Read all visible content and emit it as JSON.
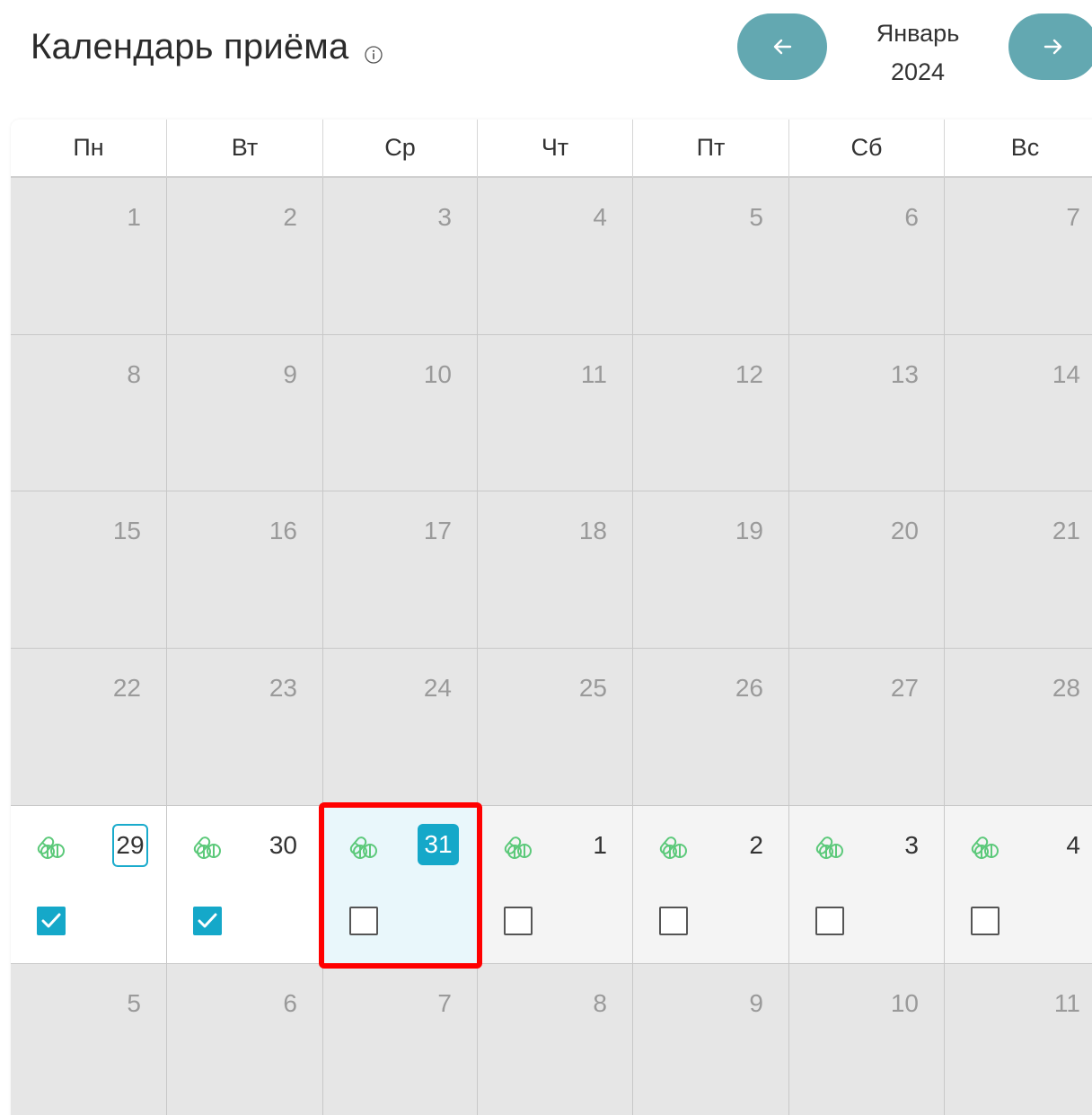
{
  "header": {
    "title": "Календарь приёма",
    "info_icon": "info-circle-icon",
    "prev_icon": "arrow-left-icon",
    "next_icon": "arrow-right-icon",
    "month": "Январь",
    "year": "2024"
  },
  "weekdays": [
    "Пн",
    "Вт",
    "Ср",
    "Чт",
    "Пт",
    "Сб",
    "Вс"
  ],
  "weeks": [
    [
      {
        "day": "1",
        "active": false
      },
      {
        "day": "2",
        "active": false
      },
      {
        "day": "3",
        "active": false
      },
      {
        "day": "4",
        "active": false
      },
      {
        "day": "5",
        "active": false
      },
      {
        "day": "6",
        "active": false
      },
      {
        "day": "7",
        "active": false
      }
    ],
    [
      {
        "day": "8",
        "active": false
      },
      {
        "day": "9",
        "active": false
      },
      {
        "day": "10",
        "active": false
      },
      {
        "day": "11",
        "active": false
      },
      {
        "day": "12",
        "active": false
      },
      {
        "day": "13",
        "active": false
      },
      {
        "day": "14",
        "active": false
      }
    ],
    [
      {
        "day": "15",
        "active": false
      },
      {
        "day": "16",
        "active": false
      },
      {
        "day": "17",
        "active": false
      },
      {
        "day": "18",
        "active": false
      },
      {
        "day": "19",
        "active": false
      },
      {
        "day": "20",
        "active": false
      },
      {
        "day": "21",
        "active": false
      }
    ],
    [
      {
        "day": "22",
        "active": false
      },
      {
        "day": "23",
        "active": false
      },
      {
        "day": "24",
        "active": false
      },
      {
        "day": "25",
        "active": false
      },
      {
        "day": "26",
        "active": false
      },
      {
        "day": "27",
        "active": false
      },
      {
        "day": "28",
        "active": false
      }
    ],
    [
      {
        "day": "29",
        "active": true,
        "pill_icon": "pills-icon",
        "checked": true,
        "mark": "outline"
      },
      {
        "day": "30",
        "active": true,
        "pill_icon": "pills-icon",
        "checked": true
      },
      {
        "day": "31",
        "active": true,
        "pill_icon": "pills-icon",
        "checked": false,
        "mark": "filled",
        "selected": true
      },
      {
        "day": "1",
        "active": true,
        "other_month": true,
        "pill_icon": "pills-icon",
        "checked": false
      },
      {
        "day": "2",
        "active": true,
        "other_month": true,
        "pill_icon": "pills-icon",
        "checked": false
      },
      {
        "day": "3",
        "active": true,
        "other_month": true,
        "pill_icon": "pills-icon",
        "checked": false
      },
      {
        "day": "4",
        "active": true,
        "other_month": true,
        "pill_icon": "pills-icon",
        "checked": false
      }
    ],
    [
      {
        "day": "5",
        "active": false
      },
      {
        "day": "6",
        "active": false
      },
      {
        "day": "7",
        "active": false
      },
      {
        "day": "8",
        "active": false
      },
      {
        "day": "9",
        "active": false
      },
      {
        "day": "10",
        "active": false
      },
      {
        "day": "11",
        "active": false
      }
    ]
  ],
  "colors": {
    "accent": "#15a8c9",
    "nav_button": "#63a8b1",
    "pill_icon": "#5cc97a",
    "highlight": "#ff0000",
    "inactive_day": "#e6e6e6"
  }
}
